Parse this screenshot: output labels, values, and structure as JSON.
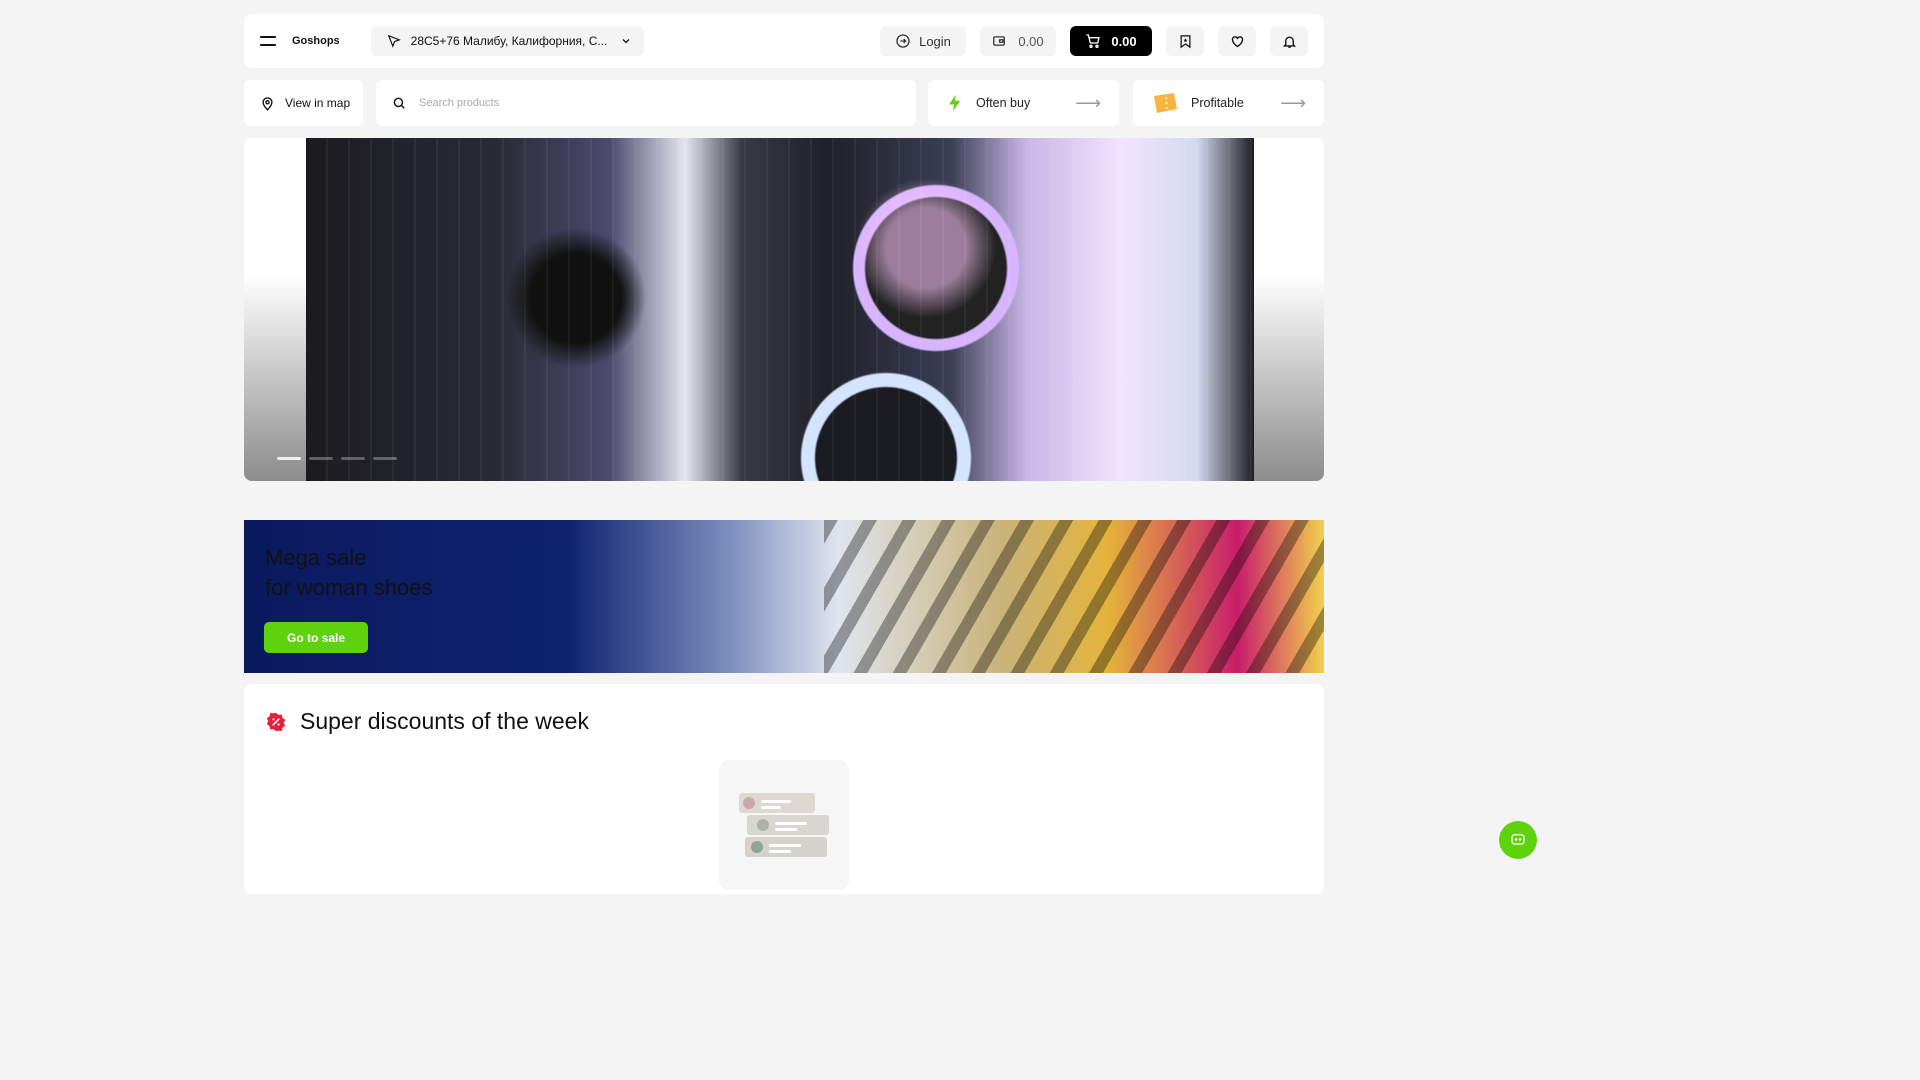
{
  "header": {
    "brand": "Goshops",
    "address": "28C5+76 Малибу, Калифорния, С...",
    "login_label": "Login",
    "wallet_amount": "0.00",
    "cart_amount": "0.00"
  },
  "toolbar": {
    "view_map_label": "View in map",
    "search_placeholder": "Search products",
    "often_buy_label": "Often buy",
    "profitable_label": "Profitable"
  },
  "hero": {
    "slides": 4,
    "active_slide": 1
  },
  "banner": {
    "title_line1": "Mega sale",
    "title_line2": "for woman shoes",
    "button_label": "Go to sale"
  },
  "discounts": {
    "title": "Super discounts of the week"
  },
  "colors": {
    "accent": "#5ed20a",
    "discount_badge": "#e8203c",
    "profit_icon": "#f7b540"
  }
}
